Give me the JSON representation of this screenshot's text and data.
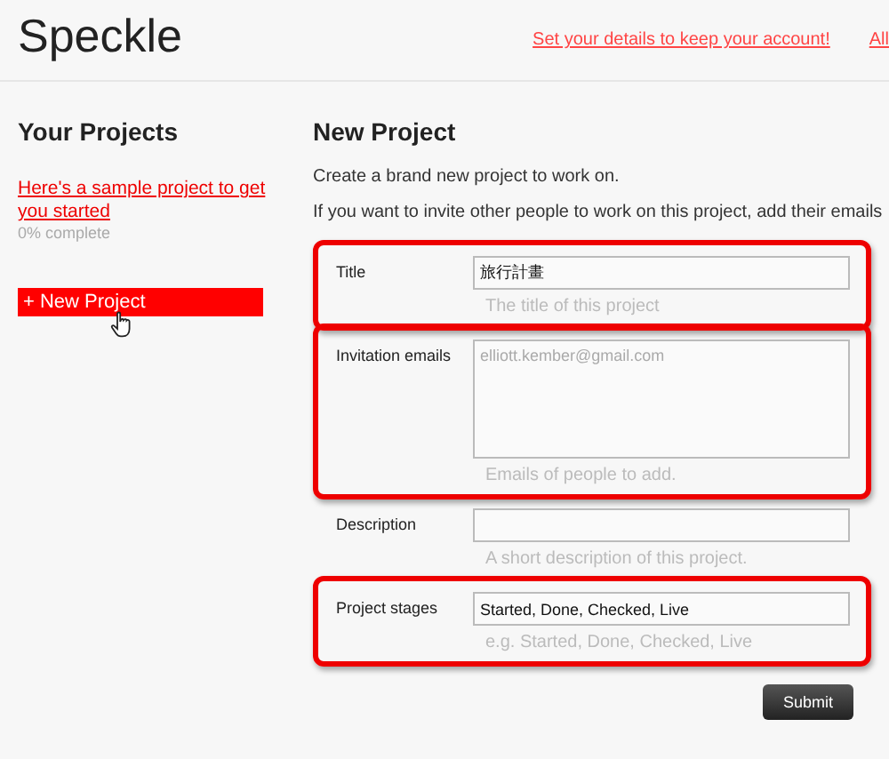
{
  "header": {
    "logo": "Speckle",
    "links": [
      "Set your details to keep your account!",
      "All"
    ]
  },
  "sidebar": {
    "title": "Your Projects",
    "projects": [
      {
        "name": "Here's a sample project to get you started",
        "progress": "0% complete"
      }
    ],
    "new_button": "+ New Project"
  },
  "form": {
    "title": "New Project",
    "intro": [
      "Create a brand new project to work on.",
      "If you want to invite other people to work on this project, add their emails"
    ],
    "fields": [
      {
        "kind": "text",
        "label": "Title",
        "value": "旅行計畫",
        "hint": "The title of this project",
        "highlighted": true
      },
      {
        "kind": "textarea",
        "label": "Invitation emails",
        "placeholder": "elliott.kember@gmail.com",
        "hint": "Emails of people to add.",
        "highlighted": true
      },
      {
        "kind": "text",
        "label": "Description",
        "hint": "A short description of this project.",
        "highlighted": false
      },
      {
        "kind": "text",
        "label": "Project stages",
        "value": "Started, Done, Checked, Live",
        "hint": "e.g. Started, Done, Checked, Live",
        "highlighted": true
      }
    ],
    "submit": "Submit"
  }
}
